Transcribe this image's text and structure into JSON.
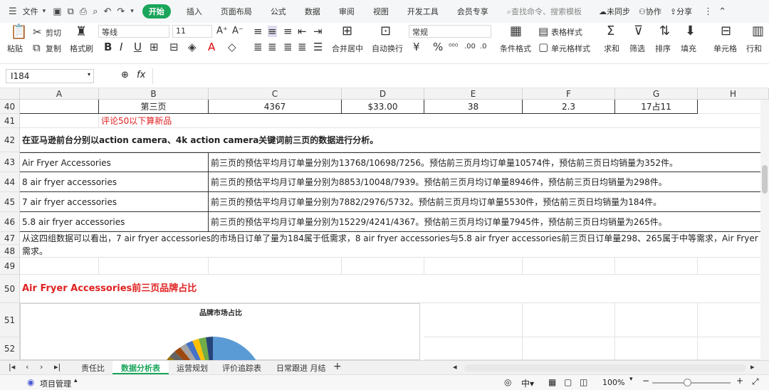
{
  "menu": {
    "file": "文件",
    "start": "开始",
    "items": [
      "插入",
      "页面布局",
      "公式",
      "数据",
      "审阅",
      "视图",
      "开发工具",
      "会员专享"
    ],
    "search": "查找命令、搜索模板",
    "sync": "未同步",
    "collab": "协作",
    "share": "分享"
  },
  "ribbon": {
    "paste": "粘贴",
    "cut": "剪切",
    "copy": "复制",
    "painter": "格式刷",
    "font": "等线",
    "size": "11",
    "merge": "合并居中",
    "wrap": "自动换行",
    "numfmt": "常规",
    "cond": "条件格式",
    "tablestyle": "表格样式",
    "cellstyle": "单元格样式",
    "sum": "求和",
    "filter": "筛选",
    "sort": "排序",
    "fill": "填充",
    "cells": "单元格",
    "rowcol": "行和"
  },
  "formula": {
    "namebox": "I184",
    "fx": "fx"
  },
  "columns": [
    "A",
    "B",
    "C",
    "D",
    "E",
    "F",
    "G",
    "H"
  ],
  "rows": {
    "r40": {
      "num": "40",
      "b": "第三页",
      "c": "4367",
      "d": "$33.00",
      "e": "38",
      "f": "2.3",
      "g": "17占11"
    },
    "r41": {
      "num": "41",
      "b": "评论50以下算新品"
    },
    "r42": {
      "num": "42",
      "a": "在亚马逊前台分别以action camera、4k action camera关键词前三页的数据进行分析。"
    },
    "r43": {
      "num": "43",
      "a": "Air Fryer Accessories",
      "c": "前三页的预估平均月订单量分别为13768/10698/7256。预估前三页月均订单量10574件，预估前三页日均销量为352件。"
    },
    "r44": {
      "num": "44",
      "a": "8 air fryer accessories",
      "c": "前三页的预估平均月订单量分别为8853/10048/7939。预估前三页月均订单量8946件，预估前三页日均销量为298件。"
    },
    "r45": {
      "num": "45",
      "a": "7 air fryer accessories",
      "c": "前三页的预估平均月订单量分别为7882/2976/5732。预估前三页月均订单量5530件，预估前三页日均销量为184件。"
    },
    "r46": {
      "num": "46",
      "a": "5.8 air fryer accessories",
      "c": "前三页的预估平均月订单量分别为15229/4241/4367。预估前三页月均订单量7945件，预估前三页日均销量为265件。"
    },
    "r47": {
      "num": "47",
      "a": "从这四组数据可以看出，7 air fryer accessories的市场日订单了量为184属于低需求，8 air fryer accessories与5.8 air fryer accessories前三页日订单量298、265属于中等需求，Air Fryer Accessories属"
    },
    "r48": {
      "num": "48",
      "a": "需求。"
    },
    "r49": {
      "num": "49"
    },
    "r50": {
      "num": "50",
      "a": "Air Fryer Accessories前三页品牌占比"
    },
    "r51": {
      "num": "51"
    },
    "r52": {
      "num": "52"
    }
  },
  "chart": {
    "title": "品牌市场占比"
  },
  "tabs": [
    "责任比",
    "数据分析表",
    "运营规划",
    "评价追踪表",
    "日常跟进 月结"
  ],
  "status": {
    "project": "项目管理",
    "zoom": "100%"
  },
  "colors": {
    "accent": "#1aa55b",
    "red": "#e02020"
  }
}
